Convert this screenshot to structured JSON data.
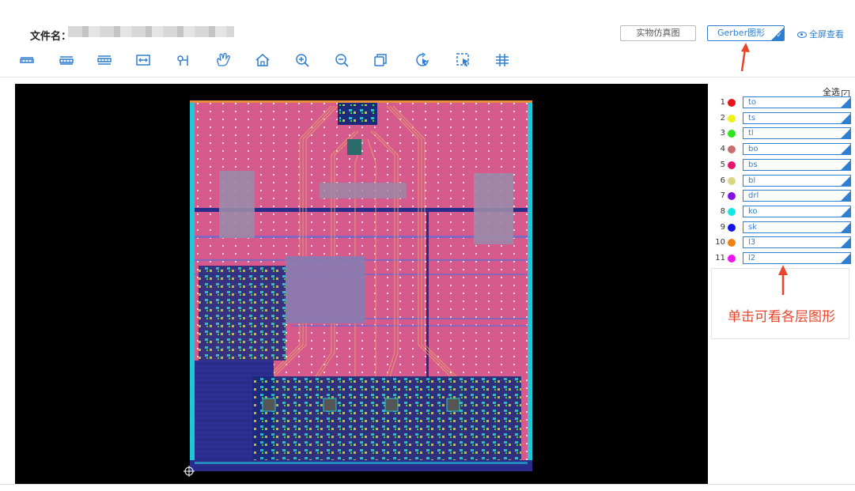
{
  "header": {
    "file_label": "文件名：",
    "sim_button": "实物仿真图",
    "gerber_button": "Gerber图形",
    "fullscreen_label": "全屏查看"
  },
  "toolbar": {
    "icons": [
      "layer-toggle-1-icon",
      "layer-toggle-2-icon",
      "layer-toggle-3-icon",
      "measure-icon",
      "probe-icon",
      "pan-icon",
      "home-icon",
      "zoom-in-icon",
      "zoom-out-icon",
      "copy-icon",
      "rotate-select-icon",
      "box-select-icon",
      "grid-icon"
    ]
  },
  "layers": {
    "select_all_label": "全选",
    "items": [
      {
        "num": "1",
        "name": "to",
        "color": "#e8141c"
      },
      {
        "num": "2",
        "name": "ts",
        "color": "#f0f014"
      },
      {
        "num": "3",
        "name": "tl",
        "color": "#2ee61c"
      },
      {
        "num": "4",
        "name": "bo",
        "color": "#c86e6e"
      },
      {
        "num": "5",
        "name": "bs",
        "color": "#e8146e"
      },
      {
        "num": "6",
        "name": "bl",
        "color": "#d8d880"
      },
      {
        "num": "7",
        "name": "drl",
        "color": "#8214e6"
      },
      {
        "num": "8",
        "name": "ko",
        "color": "#14e6e6"
      },
      {
        "num": "9",
        "name": "sk",
        "color": "#1414e6"
      },
      {
        "num": "10",
        "name": "l3",
        "color": "#f08214"
      },
      {
        "num": "11",
        "name": "l2",
        "color": "#f014f0"
      }
    ]
  },
  "annotation": {
    "hint_text": "单击可看各层图形"
  },
  "colors": {
    "accent": "#2f7fd1",
    "annotation": "#e8452a",
    "board_pink": "#d65a8c",
    "board_blue": "#2a2c8c"
  }
}
